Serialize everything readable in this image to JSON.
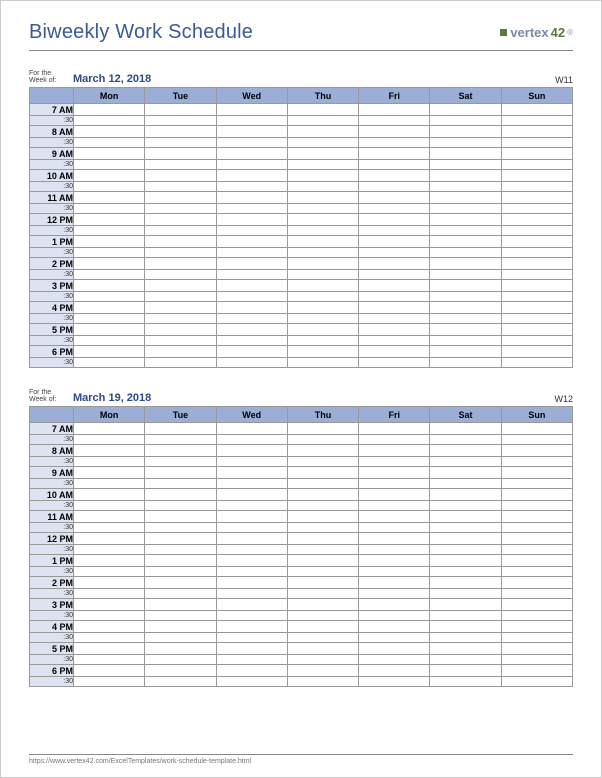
{
  "title": "Biweekly Work Schedule",
  "logo": {
    "text": "vertex",
    "suffix": "42"
  },
  "days": [
    "Mon",
    "Tue",
    "Wed",
    "Thu",
    "Fri",
    "Sat",
    "Sun"
  ],
  "hours": [
    "7 AM",
    "8 AM",
    "9 AM",
    "10 AM",
    "11 AM",
    "12 PM",
    "1 PM",
    "2 PM",
    "3 PM",
    "4 PM",
    "5 PM",
    "6 PM"
  ],
  "half_label": ":30",
  "for_label_line1": "For the",
  "for_label_line2": "Week of:",
  "weeks": [
    {
      "date": "March 12, 2018",
      "wnum": "W11"
    },
    {
      "date": "March 19, 2018",
      "wnum": "W12"
    }
  ],
  "footer": "https://www.vertex42.com/ExcelTemplates/work-schedule-template.html"
}
